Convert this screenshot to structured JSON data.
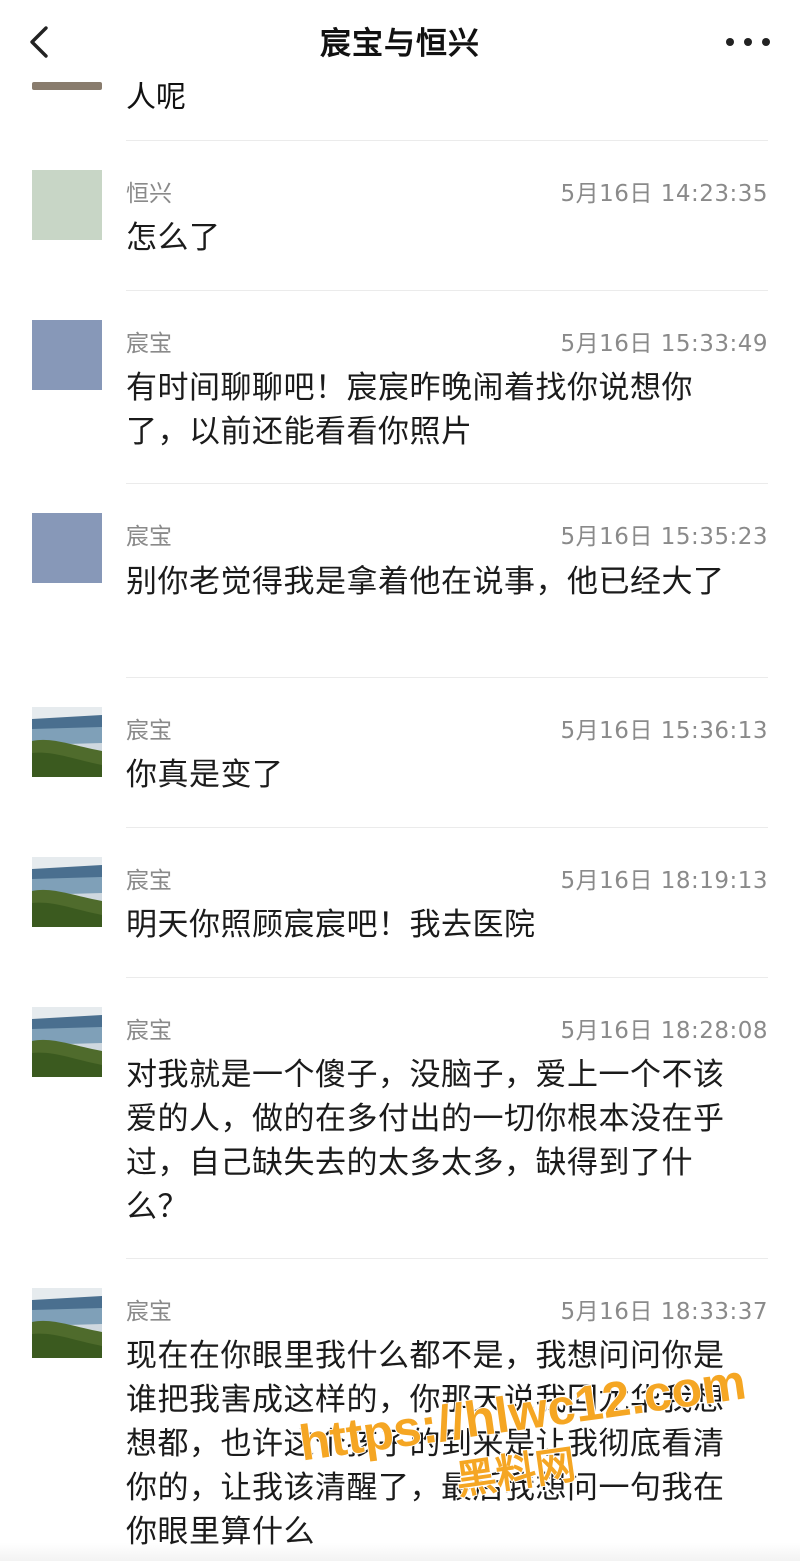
{
  "header": {
    "title": "宸宝与恒兴",
    "back_icon": "chevron-left-icon",
    "more_icon": "more-dots-icon"
  },
  "top_partial_text": "人呢",
  "messages": [
    {
      "name": "恒兴",
      "time": "5月16日 14:23:35",
      "text": "怎么了",
      "avatar": "green-square"
    },
    {
      "name": "宸宝",
      "time": "5月16日 15:33:49",
      "text": "有时间聊聊吧！宸宸昨晚闹着找你说想你了，以前还能看看你照片",
      "avatar": "blue-square"
    },
    {
      "name": "宸宝",
      "time": "5月16日 15:35:23",
      "text": "别你老觉得我是拿着他在说事，他已经大了",
      "avatar": "blue-square"
    },
    {
      "name": "宸宝",
      "time": "5月16日 15:36:13",
      "text": "你真是变了",
      "avatar": "seaside-photo"
    },
    {
      "name": "宸宝",
      "time": "5月16日 18:19:13",
      "text": "明天你照顾宸宸吧！我去医院",
      "avatar": "seaside-photo"
    },
    {
      "name": "宸宝",
      "time": "5月16日 18:28:08",
      "text": "对我就是一个傻子，没脑子，爱上一个不该爱的人，做的在多付出的一切你根本没在乎过，自己缺失去的太多太多，缺得到了什么？",
      "avatar": "seaside-photo"
    },
    {
      "name": "宸宝",
      "time": "5月16日 18:33:37",
      "text": "现在在你眼里我什么都不是，我想问问你是谁把我害成这样的，你那天说我回龙华我想想都，也许这个孩子的到来是让我彻底看清你的，让我该清醒了，最后我想问一句我在你眼里算什么",
      "avatar": "seaside-photo"
    }
  ],
  "watermark": {
    "line1": "https://hlwc12.com",
    "line2": "黑料网"
  },
  "colors": {
    "background": "#ffffff",
    "secondary_text": "#8a8a8a",
    "divider": "#ebebeb",
    "watermark": "#f5a623"
  }
}
